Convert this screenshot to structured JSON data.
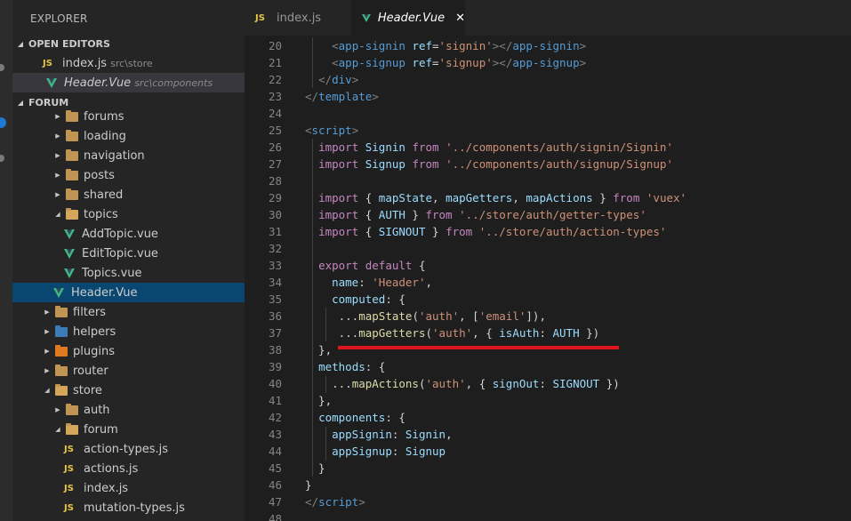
{
  "sidebar": {
    "title": "EXPLORER",
    "open_editors": {
      "label": "OPEN EDITORS",
      "items": [
        {
          "name": "index.js",
          "path": "src\\store",
          "icon": "js-icon"
        },
        {
          "name": "Header.Vue",
          "path": "src\\components",
          "icon": "vue-icon"
        }
      ]
    },
    "project": {
      "label": "FORUM",
      "tree": [
        {
          "label": "forums",
          "kind": "folder"
        },
        {
          "label": "loading",
          "kind": "folder"
        },
        {
          "label": "navigation",
          "kind": "folder"
        },
        {
          "label": "posts",
          "kind": "folder"
        },
        {
          "label": "shared",
          "kind": "folder"
        },
        {
          "label": "topics",
          "kind": "folder-open"
        },
        {
          "label": "AddTopic.vue",
          "kind": "vue"
        },
        {
          "label": "EditTopic.vue",
          "kind": "vue"
        },
        {
          "label": "Topics.vue",
          "kind": "vue"
        },
        {
          "label": "Header.Vue",
          "kind": "vue"
        },
        {
          "label": "filters",
          "kind": "folder"
        },
        {
          "label": "helpers",
          "kind": "folder"
        },
        {
          "label": "plugins",
          "kind": "folder"
        },
        {
          "label": "router",
          "kind": "folder"
        },
        {
          "label": "store",
          "kind": "folder-open"
        },
        {
          "label": "auth",
          "kind": "folder"
        },
        {
          "label": "forum",
          "kind": "folder-open"
        },
        {
          "label": "action-types.js",
          "kind": "js"
        },
        {
          "label": "actions.js",
          "kind": "js"
        },
        {
          "label": "index.js",
          "kind": "js"
        },
        {
          "label": "mutation-types.js",
          "kind": "js"
        }
      ]
    }
  },
  "tabs": [
    {
      "label": "index.js",
      "icon": "js-icon",
      "active": false
    },
    {
      "label": "Header.Vue",
      "icon": "vue-icon",
      "active": true,
      "close": "✕"
    }
  ],
  "icons": {
    "js": "JS"
  },
  "colors": {
    "accent_selection": "#094771",
    "vue_green": "#41b883",
    "js_yellow": "#e6c547",
    "annotation_red": "#e0141b"
  },
  "editor": {
    "lines": [
      {
        "n": "20",
        "tokens": [
          [
            "    ",
            "plain"
          ],
          [
            "<",
            "punct"
          ],
          [
            "app-signin",
            "tag"
          ],
          [
            " ",
            "plain"
          ],
          [
            "ref",
            "attr"
          ],
          [
            "=",
            "plain"
          ],
          [
            "'signin'",
            "str"
          ],
          [
            "></",
            "punct"
          ],
          [
            "app-signin",
            "tag"
          ],
          [
            ">",
            "punct"
          ]
        ]
      },
      {
        "n": "21",
        "tokens": [
          [
            "    ",
            "plain"
          ],
          [
            "<",
            "punct"
          ],
          [
            "app-signup",
            "tag"
          ],
          [
            " ",
            "plain"
          ],
          [
            "ref",
            "attr"
          ],
          [
            "=",
            "plain"
          ],
          [
            "'signup'",
            "str"
          ],
          [
            "></",
            "punct"
          ],
          [
            "app-signup",
            "tag"
          ],
          [
            ">",
            "punct"
          ]
        ]
      },
      {
        "n": "22",
        "tokens": [
          [
            "  ",
            "plain"
          ],
          [
            "</",
            "punct"
          ],
          [
            "div",
            "tag"
          ],
          [
            ">",
            "punct"
          ]
        ]
      },
      {
        "n": "23",
        "tokens": [
          [
            "</",
            "punct"
          ],
          [
            "template",
            "tag"
          ],
          [
            ">",
            "punct"
          ]
        ]
      },
      {
        "n": "24",
        "tokens": []
      },
      {
        "n": "25",
        "tokens": [
          [
            "<",
            "punct"
          ],
          [
            "script",
            "tag"
          ],
          [
            ">",
            "punct"
          ]
        ]
      },
      {
        "n": "26",
        "tokens": [
          [
            "  ",
            "plain"
          ],
          [
            "import",
            "kw"
          ],
          [
            " ",
            "plain"
          ],
          [
            "Signin",
            "id"
          ],
          [
            " ",
            "plain"
          ],
          [
            "from",
            "kw"
          ],
          [
            " ",
            "plain"
          ],
          [
            "'../components/auth/signin/Signin'",
            "str"
          ]
        ]
      },
      {
        "n": "27",
        "tokens": [
          [
            "  ",
            "plain"
          ],
          [
            "import",
            "kw"
          ],
          [
            " ",
            "plain"
          ],
          [
            "Signup",
            "id"
          ],
          [
            " ",
            "plain"
          ],
          [
            "from",
            "kw"
          ],
          [
            " ",
            "plain"
          ],
          [
            "'../components/auth/signup/Signup'",
            "str"
          ]
        ]
      },
      {
        "n": "28",
        "tokens": []
      },
      {
        "n": "29",
        "tokens": [
          [
            "  ",
            "plain"
          ],
          [
            "import",
            "kw"
          ],
          [
            " { ",
            "plain"
          ],
          [
            "mapState",
            "id"
          ],
          [
            ", ",
            "plain"
          ],
          [
            "mapGetters",
            "id"
          ],
          [
            ", ",
            "plain"
          ],
          [
            "mapActions",
            "id"
          ],
          [
            " } ",
            "plain"
          ],
          [
            "from",
            "kw"
          ],
          [
            " ",
            "plain"
          ],
          [
            "'vuex'",
            "str"
          ]
        ]
      },
      {
        "n": "30",
        "tokens": [
          [
            "  ",
            "plain"
          ],
          [
            "import",
            "kw"
          ],
          [
            " { ",
            "plain"
          ],
          [
            "AUTH",
            "id"
          ],
          [
            " } ",
            "plain"
          ],
          [
            "from",
            "kw"
          ],
          [
            " ",
            "plain"
          ],
          [
            "'../store/auth/getter-types'",
            "str"
          ]
        ]
      },
      {
        "n": "31",
        "tokens": [
          [
            "  ",
            "plain"
          ],
          [
            "import",
            "kw"
          ],
          [
            " { ",
            "plain"
          ],
          [
            "SIGNOUT",
            "id"
          ],
          [
            " } ",
            "plain"
          ],
          [
            "from",
            "kw"
          ],
          [
            " ",
            "plain"
          ],
          [
            "'../store/auth/action-types'",
            "str"
          ]
        ]
      },
      {
        "n": "32",
        "tokens": []
      },
      {
        "n": "33",
        "tokens": [
          [
            "  ",
            "plain"
          ],
          [
            "export",
            "kw"
          ],
          [
            " ",
            "plain"
          ],
          [
            "default",
            "kw"
          ],
          [
            " {",
            "plain"
          ]
        ]
      },
      {
        "n": "34",
        "tokens": [
          [
            "    ",
            "plain"
          ],
          [
            "name",
            "prop"
          ],
          [
            ": ",
            "plain"
          ],
          [
            "'Header'",
            "str"
          ],
          [
            ",",
            "plain"
          ]
        ]
      },
      {
        "n": "35",
        "tokens": [
          [
            "    ",
            "plain"
          ],
          [
            "computed",
            "prop"
          ],
          [
            ": {",
            "plain"
          ]
        ]
      },
      {
        "n": "36",
        "tokens": [
          [
            "     ...",
            "plain"
          ],
          [
            "mapState",
            "fn"
          ],
          [
            "(",
            "plain"
          ],
          [
            "'auth'",
            "str"
          ],
          [
            ", [",
            "plain"
          ],
          [
            "'email'",
            "str"
          ],
          [
            "]),",
            "plain"
          ]
        ]
      },
      {
        "n": "37",
        "tokens": [
          [
            "     ...",
            "plain"
          ],
          [
            "mapGetters",
            "fn"
          ],
          [
            "(",
            "plain"
          ],
          [
            "'auth'",
            "str"
          ],
          [
            ", { ",
            "plain"
          ],
          [
            "isAuth",
            "prop"
          ],
          [
            ": ",
            "plain"
          ],
          [
            "AUTH",
            "id"
          ],
          [
            " })",
            "plain"
          ]
        ]
      },
      {
        "n": "38",
        "tokens": [
          [
            "  }",
            "plain"
          ],
          [
            ",",
            "plain"
          ]
        ]
      },
      {
        "n": "39",
        "tokens": [
          [
            "  ",
            "plain"
          ],
          [
            "methods",
            "prop"
          ],
          [
            ": {",
            "plain"
          ]
        ]
      },
      {
        "n": "40",
        "tokens": [
          [
            "    ...",
            "plain"
          ],
          [
            "mapActions",
            "fn"
          ],
          [
            "(",
            "plain"
          ],
          [
            "'auth'",
            "str"
          ],
          [
            ", { ",
            "plain"
          ],
          [
            "signOut",
            "prop"
          ],
          [
            ": ",
            "plain"
          ],
          [
            "SIGNOUT",
            "id"
          ],
          [
            " })",
            "plain"
          ]
        ]
      },
      {
        "n": "41",
        "tokens": [
          [
            "  }",
            "plain"
          ],
          [
            ",",
            "plain"
          ]
        ]
      },
      {
        "n": "42",
        "tokens": [
          [
            "  ",
            "plain"
          ],
          [
            "components",
            "prop"
          ],
          [
            ": {",
            "plain"
          ]
        ]
      },
      {
        "n": "43",
        "tokens": [
          [
            "    ",
            "plain"
          ],
          [
            "appSignin",
            "prop"
          ],
          [
            ": ",
            "plain"
          ],
          [
            "Signin",
            "id"
          ],
          [
            ",",
            "plain"
          ]
        ]
      },
      {
        "n": "44",
        "tokens": [
          [
            "    ",
            "plain"
          ],
          [
            "appSignup",
            "prop"
          ],
          [
            ": ",
            "plain"
          ],
          [
            "Signup",
            "id"
          ]
        ]
      },
      {
        "n": "45",
        "tokens": [
          [
            "  }",
            "plain"
          ]
        ]
      },
      {
        "n": "46",
        "tokens": [
          [
            "}",
            "plain"
          ]
        ]
      },
      {
        "n": "47",
        "tokens": [
          [
            "</",
            "punct"
          ],
          [
            "script",
            "tag"
          ],
          [
            ">",
            "punct"
          ]
        ]
      },
      {
        "n": "48",
        "tokens": []
      }
    ]
  }
}
